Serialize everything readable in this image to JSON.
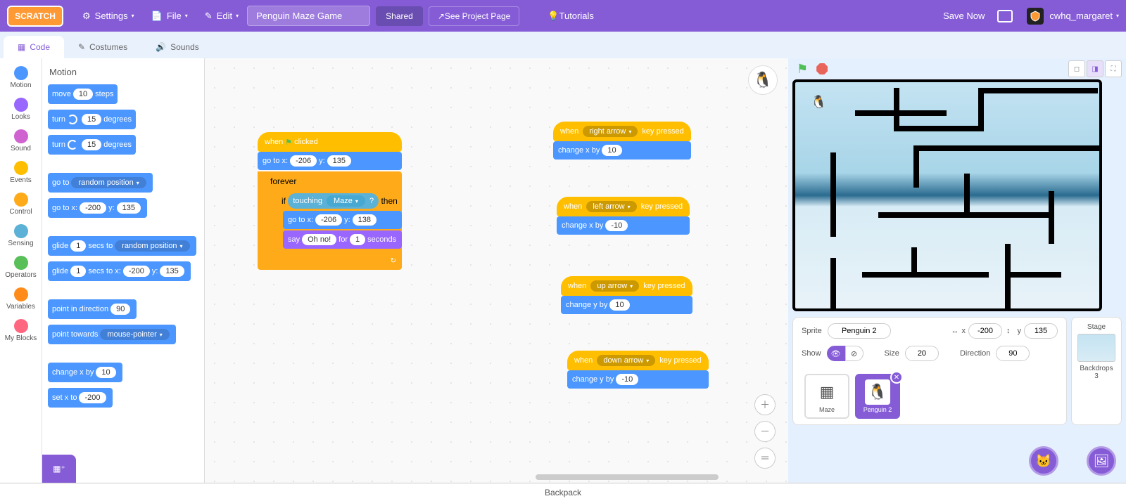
{
  "menubar": {
    "logo": "SCRATCH",
    "settings": "Settings",
    "file": "File",
    "edit": "Edit",
    "project_title": "Penguin Maze Game",
    "shared": "Shared",
    "see_page": "See Project Page",
    "tutorials": "Tutorials",
    "save_now": "Save Now",
    "username": "cwhq_margaret"
  },
  "tabs": {
    "code": "Code",
    "costumes": "Costumes",
    "sounds": "Sounds"
  },
  "categories": {
    "motion": "Motion",
    "looks": "Looks",
    "sound": "Sound",
    "events": "Events",
    "control": "Control",
    "sensing": "Sensing",
    "operators": "Operators",
    "variables": "Variables",
    "myblocks": "My Blocks"
  },
  "colors": {
    "motion": "#4c97ff",
    "looks": "#9966ff",
    "sound": "#cf63cf",
    "events": "#ffbf00",
    "control": "#ffab19",
    "sensing": "#5cb1d6",
    "operators": "#59c059",
    "variables": "#ff8c1a",
    "myblocks": "#ff6680"
  },
  "palette": {
    "title": "Motion",
    "move": {
      "label1": "move",
      "val": "10",
      "label2": "steps"
    },
    "turn_r": {
      "label1": "turn",
      "val": "15",
      "label2": "degrees"
    },
    "turn_l": {
      "label1": "turn",
      "val": "15",
      "label2": "degrees"
    },
    "goto": {
      "label": "go to",
      "target": "random position"
    },
    "goto_xy": {
      "label1": "go to x:",
      "x": "-200",
      "label2": "y:",
      "y": "135"
    },
    "glide": {
      "label1": "glide",
      "secs": "1",
      "label2": "secs to",
      "target": "random position"
    },
    "glide_xy": {
      "label1": "glide",
      "secs": "1",
      "label2": "secs to x:",
      "x": "-200",
      "label3": "y:",
      "y": "135"
    },
    "point_dir": {
      "label": "point in direction",
      "val": "90"
    },
    "point_toward": {
      "label": "point towards",
      "target": "mouse-pointer"
    },
    "change_x": {
      "label": "change x by",
      "val": "10"
    },
    "set_x": {
      "label": "set x to",
      "val": "-200"
    }
  },
  "scripts": {
    "main": {
      "hat": {
        "when": "when",
        "clicked": "clicked"
      },
      "goto": {
        "label1": "go to x:",
        "x": "-206",
        "label2": "y:",
        "y": "135"
      },
      "forever": "forever",
      "if_word": "if",
      "then_word": "then",
      "touching": {
        "label": "touching",
        "target": "Maze",
        "q": "?"
      },
      "goto2": {
        "label1": "go to x:",
        "x": "-206",
        "label2": "y:",
        "y": "138"
      },
      "say": {
        "label1": "say",
        "msg": "Oh no!",
        "label2": "for",
        "secs": "1",
        "label3": "seconds"
      }
    },
    "right": {
      "hat": {
        "when": "when",
        "key": "right arrow",
        "pressed": "key pressed"
      },
      "action": {
        "label": "change x by",
        "val": "10"
      }
    },
    "left": {
      "hat": {
        "when": "when",
        "key": "left arrow",
        "pressed": "key pressed"
      },
      "action": {
        "label": "change x by",
        "val": "-10"
      }
    },
    "up": {
      "hat": {
        "when": "when",
        "key": "up arrow",
        "pressed": "key pressed"
      },
      "action": {
        "label": "change y by",
        "val": "10"
      }
    },
    "down": {
      "hat": {
        "when": "when",
        "key": "down arrow",
        "pressed": "key pressed"
      },
      "action": {
        "label": "change y by",
        "val": "-10"
      }
    }
  },
  "sprite_info": {
    "sprite_label": "Sprite",
    "name": "Penguin 2",
    "x_label": "x",
    "x": "-200",
    "y_label": "y",
    "y": "135",
    "show_label": "Show",
    "size_label": "Size",
    "size": "20",
    "dir_label": "Direction",
    "dir": "90"
  },
  "sprites": {
    "maze": "Maze",
    "penguin": "Penguin 2"
  },
  "stage_section": {
    "title": "Stage",
    "backdrops_label": "Backdrops",
    "count": "3"
  },
  "backpack": "Backpack"
}
